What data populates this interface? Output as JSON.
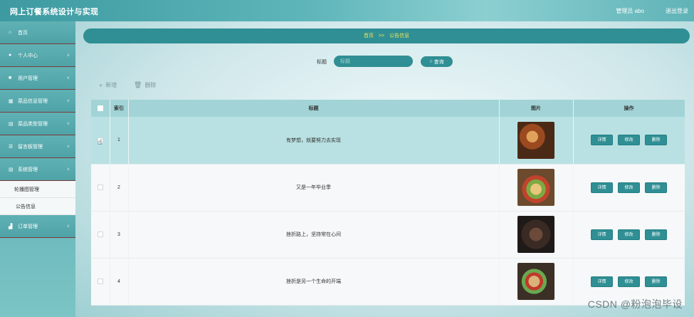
{
  "topbar": {
    "title": "网上订餐系统设计与实现",
    "admin": "管理员 abo",
    "logout": "退出登录"
  },
  "sidebar": {
    "items": [
      {
        "label": "首页",
        "icon": "home-icon"
      },
      {
        "label": "个人中心",
        "icon": "user-icon"
      },
      {
        "label": "用户管理",
        "icon": "briefcase-icon"
      },
      {
        "label": "菜品信息管理",
        "icon": "grid-icon"
      },
      {
        "label": "菜品类型管理",
        "icon": "doc-icon"
      },
      {
        "label": "留言板管理",
        "icon": "list-icon"
      },
      {
        "label": "系统管理",
        "icon": "doc-icon"
      }
    ],
    "subitems": [
      "轮播图管理",
      "公告信息"
    ],
    "last_item": {
      "label": "订单管理",
      "icon": "chart-icon"
    }
  },
  "breadcrumb": {
    "home": "首页",
    "sep": ">>",
    "current": "公告信息"
  },
  "search": {
    "label": "标题",
    "placeholder": "标题",
    "button": "查询"
  },
  "toolbar": {
    "add": "新增",
    "delete": "删除"
  },
  "table": {
    "headers": {
      "index": "索引",
      "title": "标题",
      "image": "图片",
      "ops": "操作"
    },
    "rows": [
      {
        "index": "1",
        "title": "有梦想，就要努力去实现"
      },
      {
        "index": "2",
        "title": "又是一年毕业季"
      },
      {
        "index": "3",
        "title": "挫折路上，坚持常在心间"
      },
      {
        "index": "4",
        "title": "挫折是另一个生命的开端"
      }
    ],
    "ops": {
      "detail": "详情",
      "edit": "修改",
      "delete": "删除"
    }
  },
  "watermark": "CSDN @粉泡泡毕设",
  "colors": {
    "accent": "#2f8f94",
    "breadcrumb_text": "#f3e45a",
    "header_row": "#a2d4d7"
  }
}
